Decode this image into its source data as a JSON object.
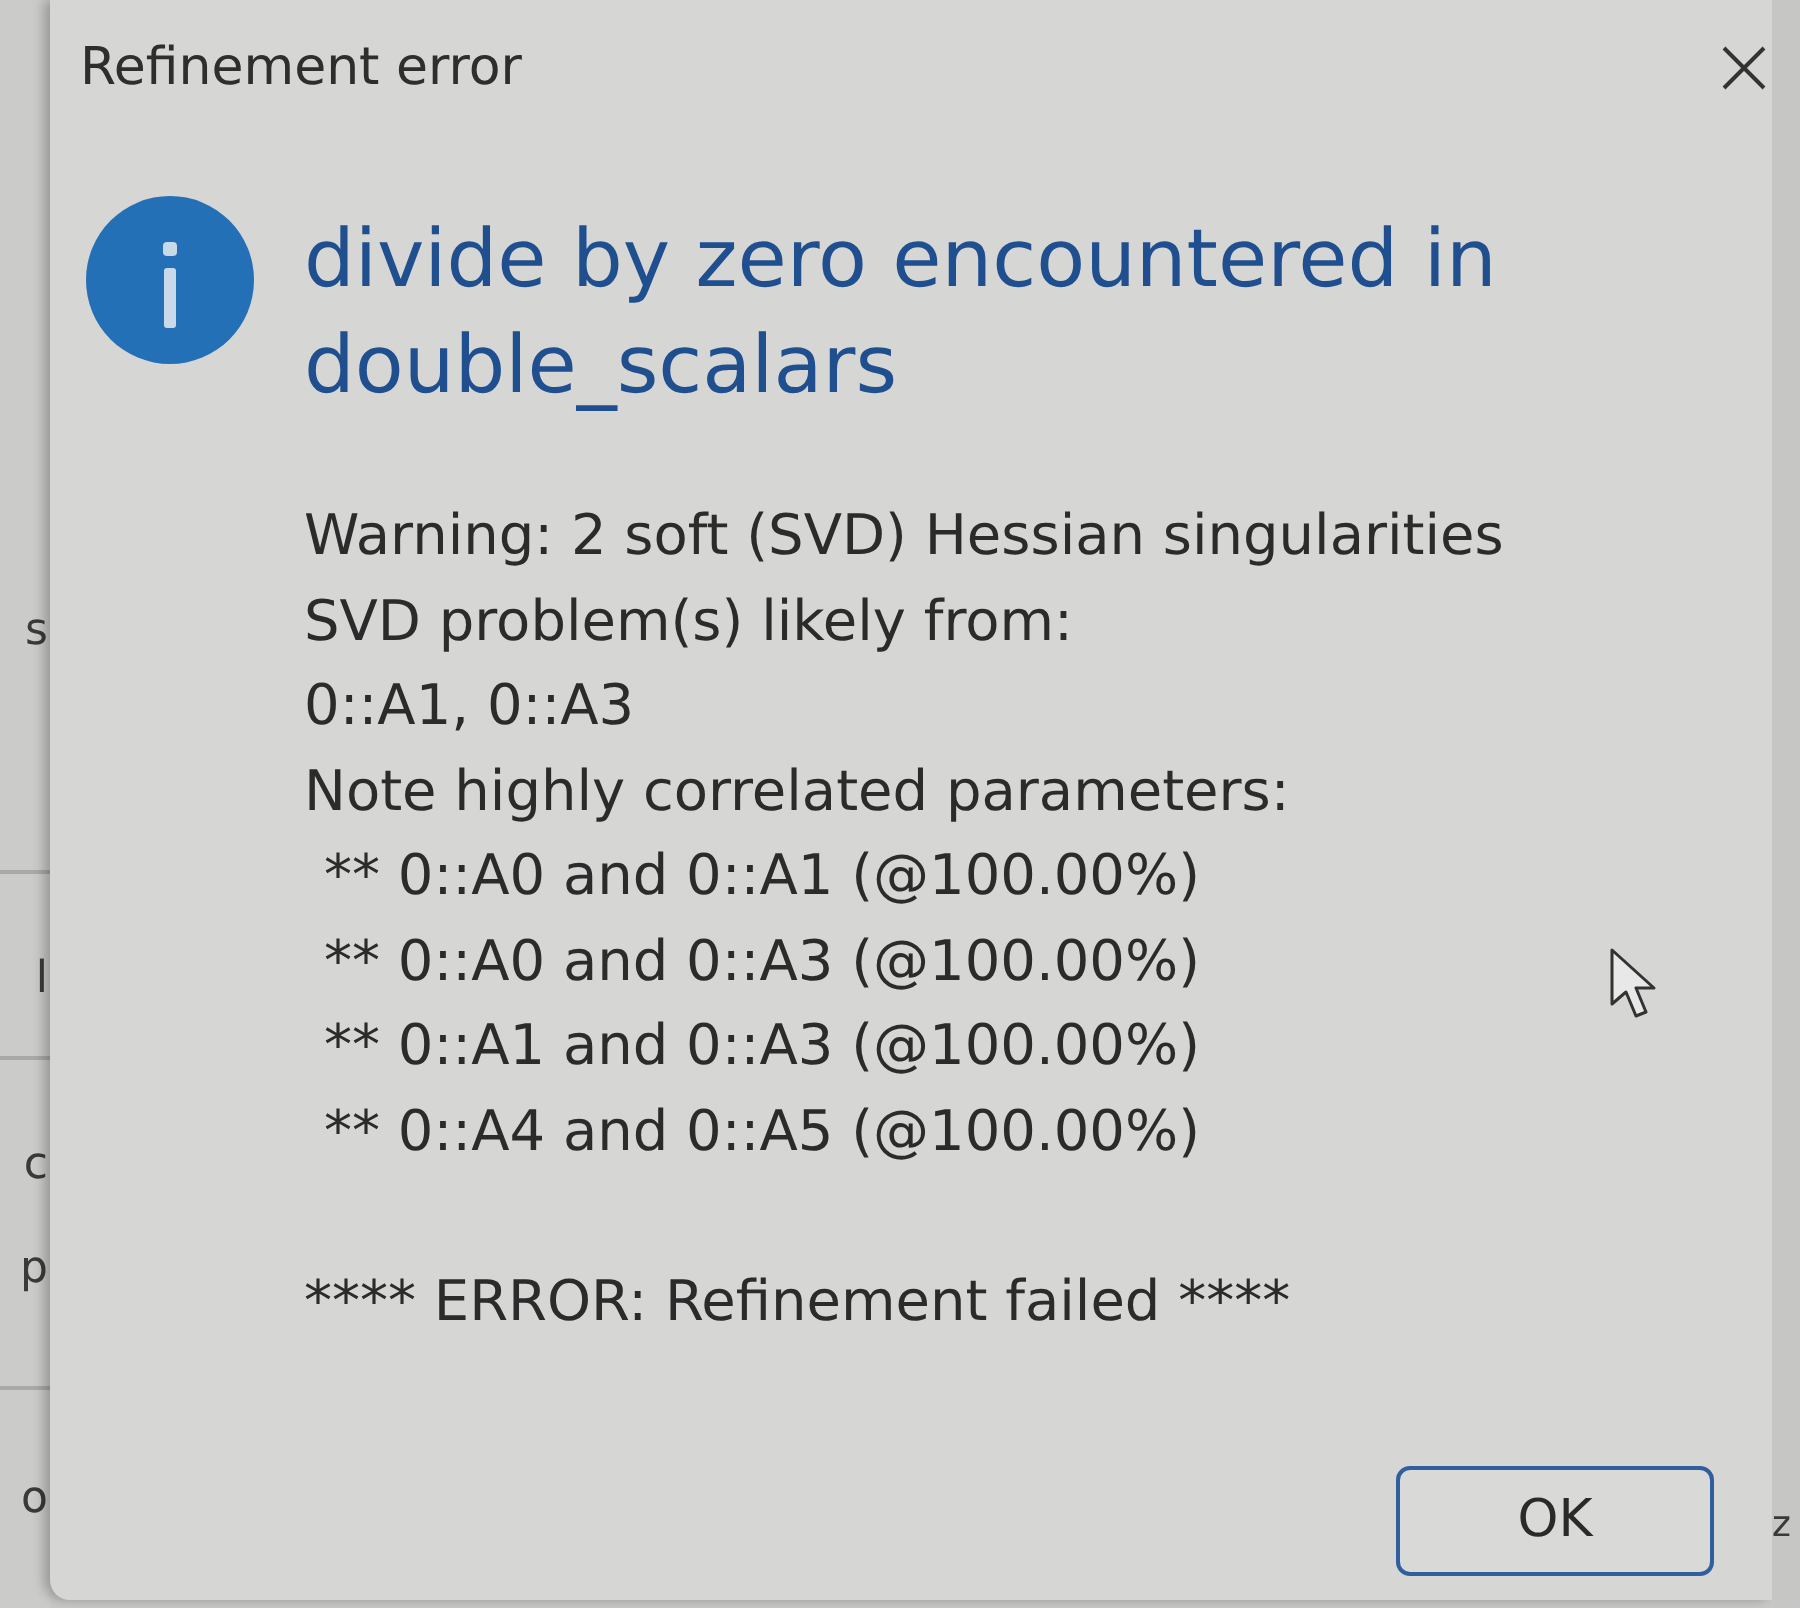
{
  "background_window": {
    "left_fragments": [
      "s",
      "l",
      "c",
      "p",
      "o"
    ],
    "right_fragments": [
      "z"
    ]
  },
  "dialog": {
    "title": "Refinement error",
    "heading": "divide by zero encountered in double_scalars",
    "details": {
      "warning": "Warning: 2 soft (SVD) Hessian singularities",
      "svd_problem": "SVD problem(s) likely from:",
      "svd_parameters": "0::A1, 0::A3",
      "note": "Note highly correlated parameters:",
      "correlations": [
        "** 0::A0 and 0::A1 (@100.00%)",
        "** 0::A0 and 0::A3 (@100.00%)",
        "** 0::A1 and 0::A3 (@100.00%)",
        "** 0::A4 and 0::A5 (@100.00%)"
      ],
      "error": "**** ERROR: Refinement failed ****"
    },
    "buttons": [
      "OK"
    ]
  }
}
